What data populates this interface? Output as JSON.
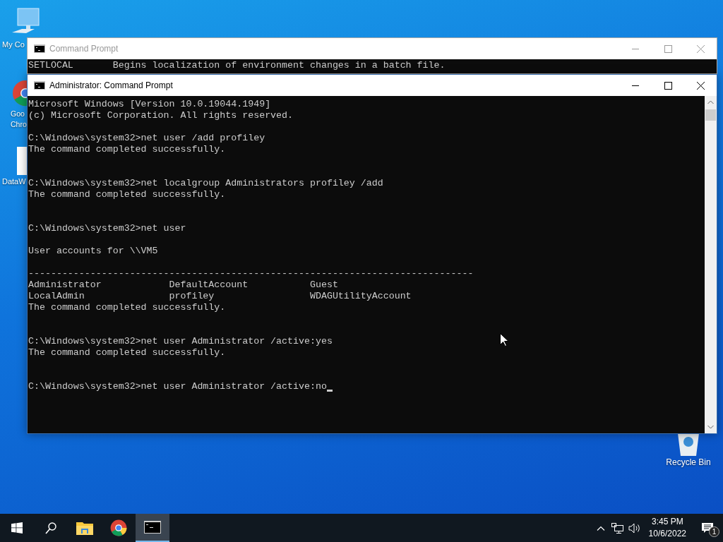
{
  "desktop_icons": [
    {
      "kind": "computer",
      "label_lines": [
        "My Co"
      ]
    },
    {
      "kind": "browser",
      "label_lines": [
        "Goo",
        "Chro"
      ]
    },
    {
      "kind": "document",
      "label_lines": [
        "DataW"
      ]
    },
    {
      "kind": "recycle",
      "label_lines": [
        "Recycle Bin"
      ]
    }
  ],
  "back_window": {
    "title": "Command Prompt",
    "active": false,
    "lines": [
      "SETLOCAL       Begins localization of environment changes in a batch file."
    ]
  },
  "front_window": {
    "title": "Administrator: Command Prompt",
    "active": true,
    "lines": [
      {
        "kind": "text",
        "text": "Microsoft Windows [Version 10.0.19044.1949]"
      },
      {
        "kind": "text",
        "text": "(c) Microsoft Corporation. All rights reserved."
      },
      {
        "kind": "blank"
      },
      {
        "kind": "text",
        "text": "C:\\Windows\\system32>net user /add profiley"
      },
      {
        "kind": "text",
        "text": "The command completed successfully."
      },
      {
        "kind": "blank"
      },
      {
        "kind": "blank"
      },
      {
        "kind": "text",
        "text": "C:\\Windows\\system32>net localgroup Administrators profiley /add"
      },
      {
        "kind": "text",
        "text": "The command completed successfully."
      },
      {
        "kind": "blank"
      },
      {
        "kind": "blank"
      },
      {
        "kind": "text",
        "text": "C:\\Windows\\system32>net user"
      },
      {
        "kind": "blank"
      },
      {
        "kind": "text",
        "text": "User accounts for \\\\VM5"
      },
      {
        "kind": "blank"
      },
      {
        "kind": "text",
        "text": "-------------------------------------------------------------------------------"
      },
      {
        "kind": "text",
        "text": "Administrator            DefaultAccount           Guest"
      },
      {
        "kind": "text",
        "text": "LocalAdmin               profiley                 WDAGUtilityAccount"
      },
      {
        "kind": "text",
        "text": "The command completed successfully."
      },
      {
        "kind": "blank"
      },
      {
        "kind": "blank"
      },
      {
        "kind": "text",
        "text": "C:\\Windows\\system32>net user Administrator /active:yes"
      },
      {
        "kind": "text",
        "text": "The command completed successfully."
      },
      {
        "kind": "blank"
      },
      {
        "kind": "blank"
      },
      {
        "kind": "text",
        "text": "C:\\Windows\\system32>net user Administrator /active:no",
        "cursor": true
      }
    ]
  },
  "taskbar": {
    "apps": [
      {
        "kind": "explorer",
        "selected": false
      },
      {
        "kind": "chrome",
        "selected": false
      },
      {
        "kind": "terminal",
        "selected": true
      }
    ],
    "time": "3:45 PM",
    "date": "10/6/2022",
    "notifications": "1"
  }
}
